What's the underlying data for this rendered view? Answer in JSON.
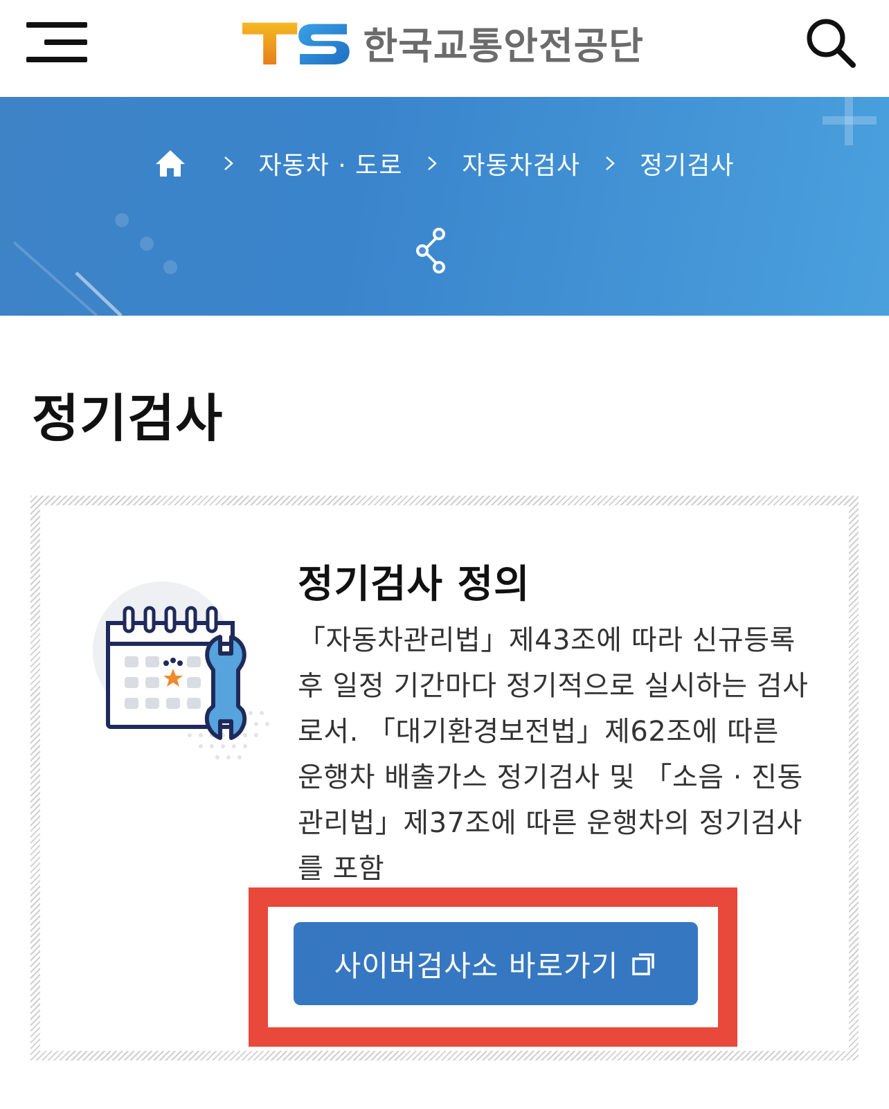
{
  "header": {
    "logo_mark": "TS",
    "logo_text": "한국교통안전공단",
    "menu_icon": "hamburger-menu-icon",
    "search_icon": "search-icon"
  },
  "breadcrumb": {
    "home_icon": "home-icon",
    "items": [
      "자동차 · 도로",
      "자동차검사",
      "정기검사"
    ],
    "share_icon": "share-icon"
  },
  "page": {
    "title": "정기검사"
  },
  "card": {
    "title": "정기검사 정의",
    "description": "「자동차관리법」제43조에 따라 신규등록 후 일정 기간마다 정기적으로 실시하는 검사로서. 「대기환경보전법」제62조에 따른 운행차 배출가스 정기검사 및 「소음 · 진동관리법」제37조에 따른 운행차의 정기검사를 포함",
    "illustration_icon": "calendar-wrench-icon"
  },
  "cta": {
    "label": "사이버검사소 바로가기",
    "icon": "new-window-icon"
  },
  "colors": {
    "banner_blue": "#3e83c6",
    "button_blue": "#3677c1",
    "highlight_red": "#e8493b",
    "logo_orange": "#f0a020",
    "logo_blue": "#2f86d3"
  }
}
